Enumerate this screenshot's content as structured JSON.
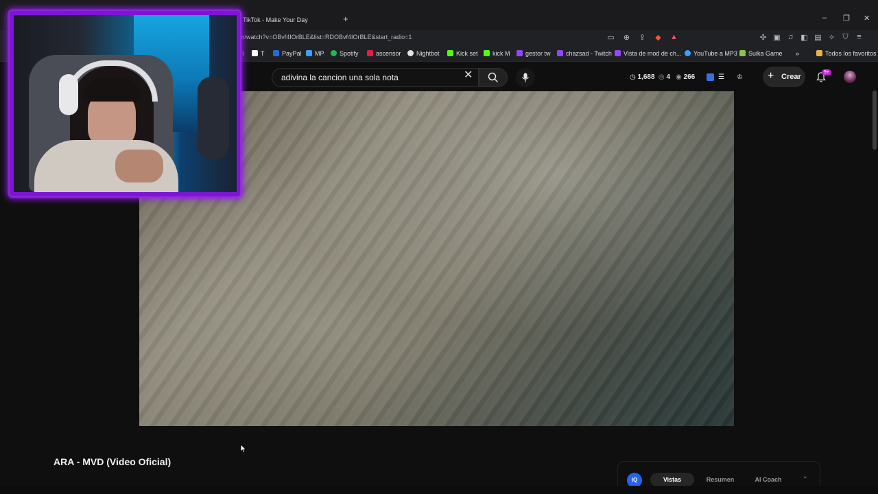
{
  "browser": {
    "tab_title": "TikTok - Make Your Day",
    "new_tab": "+",
    "url": "m/watch?v=OBvf4IOrBLE&list=RDOBvf4IOrBLE&start_radio=1",
    "window_controls": {
      "minimize": "–",
      "restore": "❐",
      "close": "✕"
    },
    "bookmarks": [
      {
        "label": "I",
        "color": "#202124"
      },
      {
        "label": "T",
        "color": "#ffffff",
        "icon": "x-icon"
      },
      {
        "label": "PayPal",
        "color": "#1f6fd1"
      },
      {
        "label": "MP",
        "color": "#3aa0ff"
      },
      {
        "label": "Spotify",
        "color": "#1db954"
      },
      {
        "label": "ascensor",
        "color": "#e11d48"
      },
      {
        "label": "Nightbot",
        "color": "#e5e5e5"
      },
      {
        "label": "Kick set",
        "color": "#53fc18"
      },
      {
        "label": "kick M",
        "color": "#53fc18"
      },
      {
        "label": "gestor tw",
        "color": "#9146ff"
      },
      {
        "label": "chazsad - Twitch",
        "color": "#9146ff"
      },
      {
        "label": "Vista de mod de ch...",
        "color": "#9146ff"
      },
      {
        "label": "YouTube a MP3",
        "color": "#3aa0ff"
      },
      {
        "label": "Suika Game",
        "color": "#8bc34a"
      },
      {
        "label": "»",
        "color": "#202124"
      },
      {
        "label": "Todos los favoritos",
        "color": "#e8b34b"
      }
    ]
  },
  "youtube": {
    "search_value": "adivina la cancion una sola nota",
    "stats": {
      "watch_time": "1,688",
      "eye_count": "4",
      "views": "266"
    },
    "create_label": "Crear",
    "notification_badge": "9+",
    "video_title": "ARA - MVD (Video Oficial)",
    "iq_panel": {
      "logo": "IQ",
      "tabs": [
        "Vistas",
        "Resumen",
        "AI Coach"
      ],
      "active_tab": "Vistas",
      "chevron": "⌃"
    }
  },
  "colors": {
    "accent_purple": "#8a1be0",
    "yt_bg": "#0f0f0f"
  }
}
